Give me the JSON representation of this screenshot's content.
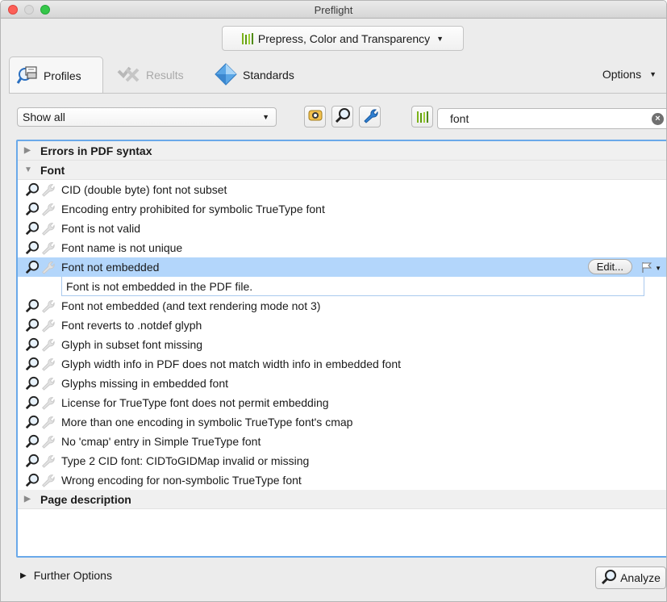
{
  "window": {
    "title": "Preflight"
  },
  "profile_select": {
    "value": "Prepress, Color and Transparency",
    "icon": "library-bars-icon"
  },
  "tabs": [
    {
      "label": "Profiles",
      "active": true,
      "icon": "profiles-icon"
    },
    {
      "label": "Results",
      "enabled": false,
      "icon": "results-icon"
    },
    {
      "label": "Standards",
      "icon": "standards-icon"
    }
  ],
  "options_label": "Options",
  "filter": {
    "show_value": "Show all",
    "search_value": "font"
  },
  "list": {
    "groups": [
      {
        "label": "Errors in PDF syntax",
        "expanded": false
      },
      {
        "label": "Font",
        "expanded": true
      },
      {
        "label": "Page description",
        "expanded": false
      }
    ],
    "font_items": [
      "CID (double byte) font not subset",
      "Encoding entry prohibited for symbolic TrueType font",
      "Font is not valid",
      "Font name is not unique",
      "Font not embedded",
      "Font not embedded (and text rendering mode not 3)",
      "Font reverts to .notdef glyph",
      "Glyph in subset font missing",
      "Glyph width info in PDF does not match width info in embedded font",
      "Glyphs missing in embedded font",
      "License for TrueType font does not permit embedding",
      "More than one encoding in symbolic TrueType font's cmap",
      "No 'cmap' entry in Simple TrueType font",
      "Type 2 CID font: CIDToGIDMap invalid or missing",
      "Wrong encoding for non-symbolic TrueType font"
    ],
    "selected_index": 4,
    "selected_description": "Font is not embedded in the PDF file.",
    "edit_label": "Edit..."
  },
  "further_options_label": "Further Options",
  "analyze_label": "Analyze",
  "colors": {
    "selection": "#b3d6fb",
    "focus_ring": "#6aa9e9",
    "close": "#fc5f57",
    "maximize": "#35c749"
  }
}
